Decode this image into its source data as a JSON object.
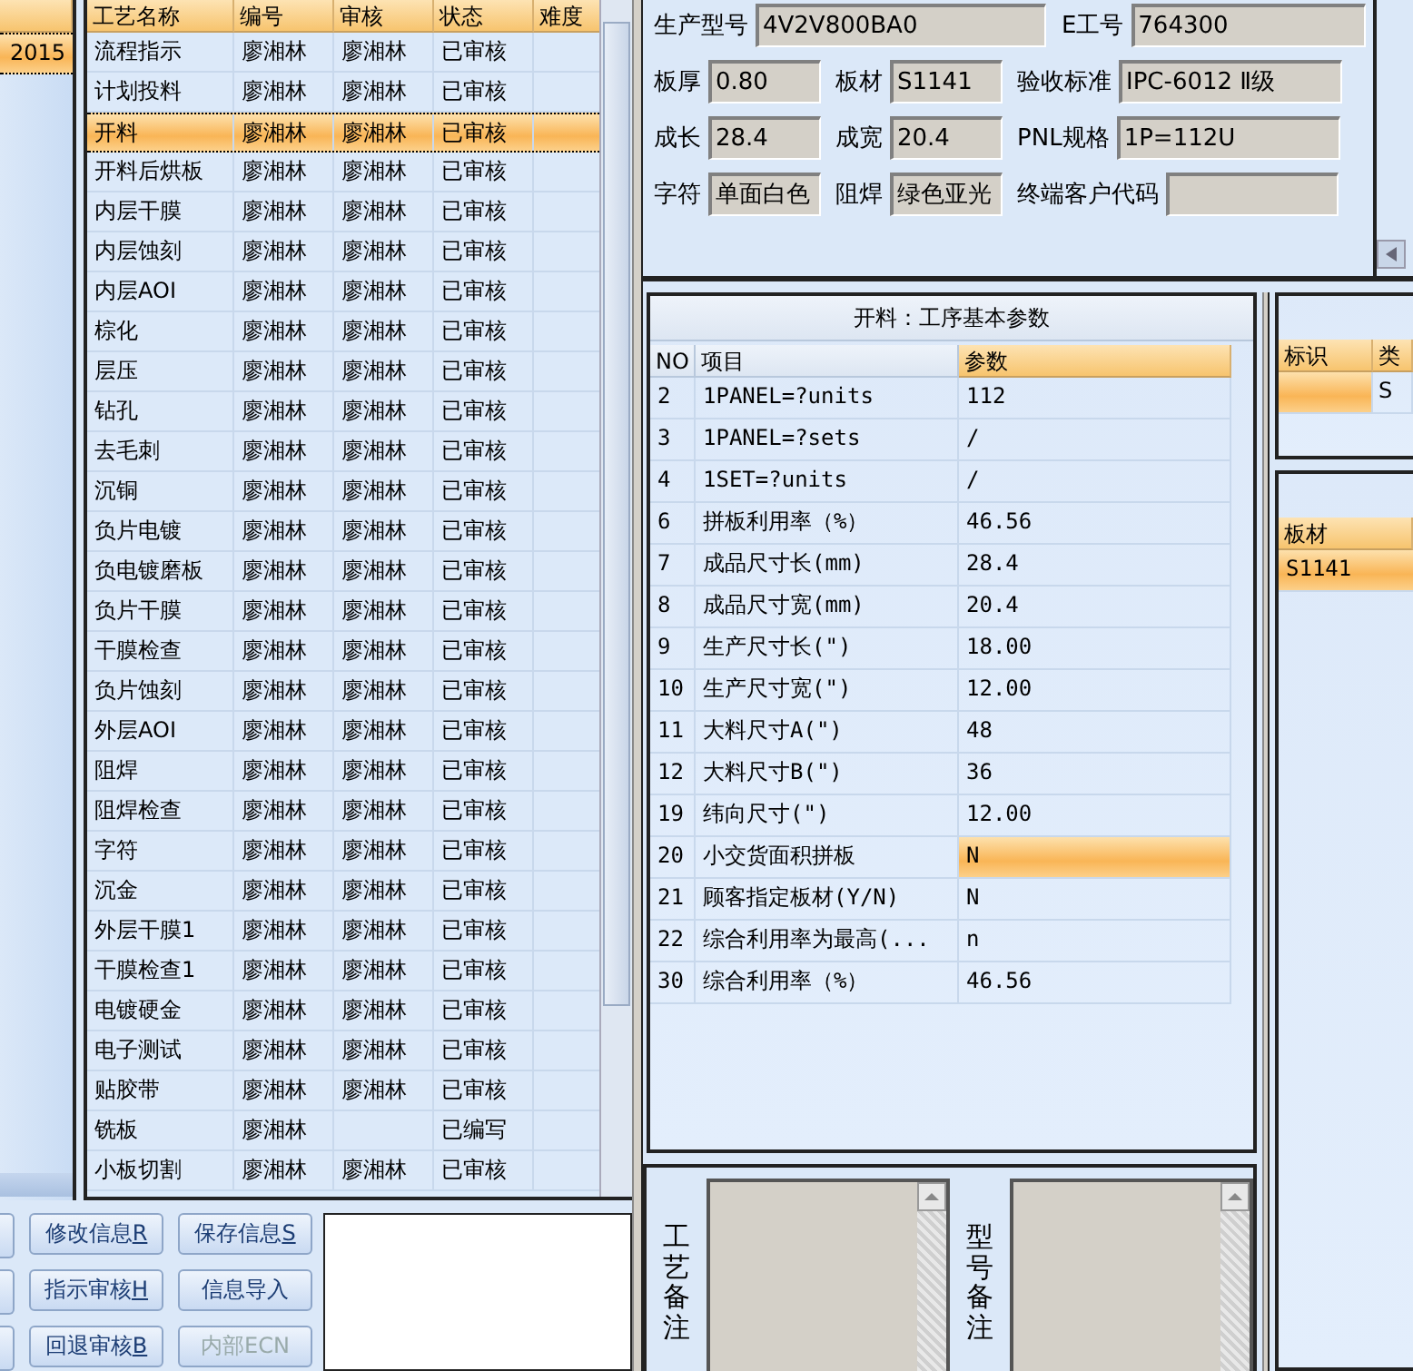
{
  "customer_list": {
    "rows": [
      {
        "value": "2015",
        "selected": true
      }
    ]
  },
  "process_table": {
    "columns": [
      "工艺名称",
      "编号",
      "审核",
      "状态",
      "难度"
    ],
    "rows": [
      {
        "name": "流程指示",
        "code": "廖湘林",
        "reviewer": "廖湘林",
        "status": "已审核",
        "selected": false
      },
      {
        "name": "计划投料",
        "code": "廖湘林",
        "reviewer": "廖湘林",
        "status": "已审核",
        "selected": false
      },
      {
        "name": "开料",
        "code": "廖湘林",
        "reviewer": "廖湘林",
        "status": "已审核",
        "selected": true
      },
      {
        "name": "开料后烘板",
        "code": "廖湘林",
        "reviewer": "廖湘林",
        "status": "已审核",
        "selected": false
      },
      {
        "name": "内层干膜",
        "code": "廖湘林",
        "reviewer": "廖湘林",
        "status": "已审核",
        "selected": false
      },
      {
        "name": "内层蚀刻",
        "code": "廖湘林",
        "reviewer": "廖湘林",
        "status": "已审核",
        "selected": false
      },
      {
        "name": "内层AOI",
        "code": "廖湘林",
        "reviewer": "廖湘林",
        "status": "已审核",
        "selected": false
      },
      {
        "name": "棕化",
        "code": "廖湘林",
        "reviewer": "廖湘林",
        "status": "已审核",
        "selected": false
      },
      {
        "name": "层压",
        "code": "廖湘林",
        "reviewer": "廖湘林",
        "status": "已审核",
        "selected": false
      },
      {
        "name": "钻孔",
        "code": "廖湘林",
        "reviewer": "廖湘林",
        "status": "已审核",
        "selected": false
      },
      {
        "name": "去毛刺",
        "code": "廖湘林",
        "reviewer": "廖湘林",
        "status": "已审核",
        "selected": false
      },
      {
        "name": "沉铜",
        "code": "廖湘林",
        "reviewer": "廖湘林",
        "status": "已审核",
        "selected": false
      },
      {
        "name": "负片电镀",
        "code": "廖湘林",
        "reviewer": "廖湘林",
        "status": "已审核",
        "selected": false
      },
      {
        "name": "负电镀磨板",
        "code": "廖湘林",
        "reviewer": "廖湘林",
        "status": "已审核",
        "selected": false
      },
      {
        "name": "负片干膜",
        "code": "廖湘林",
        "reviewer": "廖湘林",
        "status": "已审核",
        "selected": false
      },
      {
        "name": "干膜检查",
        "code": "廖湘林",
        "reviewer": "廖湘林",
        "status": "已审核",
        "selected": false
      },
      {
        "name": "负片蚀刻",
        "code": "廖湘林",
        "reviewer": "廖湘林",
        "status": "已审核",
        "selected": false
      },
      {
        "name": "外层AOI",
        "code": "廖湘林",
        "reviewer": "廖湘林",
        "status": "已审核",
        "selected": false
      },
      {
        "name": "阻焊",
        "code": "廖湘林",
        "reviewer": "廖湘林",
        "status": "已审核",
        "selected": false
      },
      {
        "name": "阻焊检查",
        "code": "廖湘林",
        "reviewer": "廖湘林",
        "status": "已审核",
        "selected": false
      },
      {
        "name": "字符",
        "code": "廖湘林",
        "reviewer": "廖湘林",
        "status": "已审核",
        "selected": false
      },
      {
        "name": "沉金",
        "code": "廖湘林",
        "reviewer": "廖湘林",
        "status": "已审核",
        "selected": false
      },
      {
        "name": "外层干膜1",
        "code": "廖湘林",
        "reviewer": "廖湘林",
        "status": "已审核",
        "selected": false
      },
      {
        "name": "干膜检查1",
        "code": "廖湘林",
        "reviewer": "廖湘林",
        "status": "已审核",
        "selected": false
      },
      {
        "name": "电镀硬金",
        "code": "廖湘林",
        "reviewer": "廖湘林",
        "status": "已审核",
        "selected": false
      },
      {
        "name": "电子测试",
        "code": "廖湘林",
        "reviewer": "廖湘林",
        "status": "已审核",
        "selected": false
      },
      {
        "name": "贴胶带",
        "code": "廖湘林",
        "reviewer": "廖湘林",
        "status": "已审核",
        "selected": false
      },
      {
        "name": "铣板",
        "code": "廖湘林",
        "status": "已编写",
        "selected": false
      },
      {
        "name": "小板切割",
        "code": "廖湘林",
        "reviewer": "廖湘林",
        "status": "已审核",
        "selected": false
      }
    ]
  },
  "buttons": [
    {
      "label": "修改信息",
      "hotkey": "R",
      "disabled": false
    },
    {
      "label": "保存信息",
      "hotkey": "S",
      "disabled": false
    },
    {
      "label": "指示审核",
      "hotkey": "H",
      "disabled": false
    },
    {
      "label": "信息导入",
      "disabled": false
    },
    {
      "label": "回退审核",
      "hotkey": "B",
      "disabled": false
    },
    {
      "label": "内部ECN",
      "disabled": true
    }
  ],
  "info_fields": [
    [
      {
        "label": "生产型号",
        "value": "4V2V800BA0"
      },
      {
        "label": "E工号",
        "value": "764300"
      }
    ],
    [
      {
        "label": "板厚",
        "value": "0.80"
      },
      {
        "label": "板材",
        "value": "S1141"
      },
      {
        "label": "验收标准",
        "value": "IPC-6012 Ⅱ级"
      }
    ],
    [
      {
        "label": "成长",
        "value": "28.4"
      },
      {
        "label": "成宽",
        "value": "20.4"
      },
      {
        "label": "PNL规格",
        "value": "1P=112U"
      }
    ],
    [
      {
        "label": "字符",
        "value": "单面白色"
      },
      {
        "label": "阻焊",
        "value": "绿色亚光"
      },
      {
        "label": "终端客户代码"
      }
    ]
  ],
  "params": {
    "title": "开料：工序基本参数",
    "columns": [
      "NO",
      "项目",
      "参数"
    ],
    "rows": [
      {
        "no": "2",
        "item": "1PANEL=?units",
        "value": "112",
        "selected": false
      },
      {
        "no": "3",
        "item": "1PANEL=?sets",
        "value": "/",
        "selected": false
      },
      {
        "no": "4",
        "item": "1SET=?units",
        "value": "/",
        "selected": false
      },
      {
        "no": "6",
        "item": "拼板利用率（%）",
        "value": "46.56",
        "selected": false
      },
      {
        "no": "7",
        "item": "成品尺寸长(mm)",
        "value": "28.4",
        "selected": false
      },
      {
        "no": "8",
        "item": "成品尺寸宽(mm)",
        "value": "20.4",
        "selected": false
      },
      {
        "no": "9",
        "item": "生产尺寸长(\")",
        "value": "18.00",
        "selected": false
      },
      {
        "no": "10",
        "item": "生产尺寸宽(\")",
        "value": "12.00",
        "selected": false
      },
      {
        "no": "11",
        "item": "大料尺寸A(\")",
        "value": "48",
        "selected": false
      },
      {
        "no": "12",
        "item": "大料尺寸B(\")",
        "value": "36",
        "selected": false
      },
      {
        "no": "19",
        "item": "纬向尺寸(\")",
        "value": "12.00",
        "selected": false
      },
      {
        "no": "20",
        "item": "小交货面积拼板",
        "value": "N",
        "selected": true
      },
      {
        "no": "21",
        "item": "顾客指定板材(Y/N)",
        "value": "N",
        "selected": false
      },
      {
        "no": "22",
        "item": "综合利用率为最高(...",
        "value": "n",
        "selected": false
      },
      {
        "no": "30",
        "item": "综合利用率（%）",
        "value": "46.56",
        "selected": false
      }
    ]
  },
  "mark_table": {
    "columns": [
      "标识",
      "类"
    ],
    "rows": [
      {
        "column_2": "S",
        "selected": true
      }
    ]
  },
  "material_table": {
    "columns": [
      "板材"
    ],
    "rows": [
      {
        "value": "S1141",
        "selected": true
      }
    ]
  },
  "notes": [
    {
      "label": "工艺备注"
    },
    {
      "label": "型号备注"
    }
  ]
}
